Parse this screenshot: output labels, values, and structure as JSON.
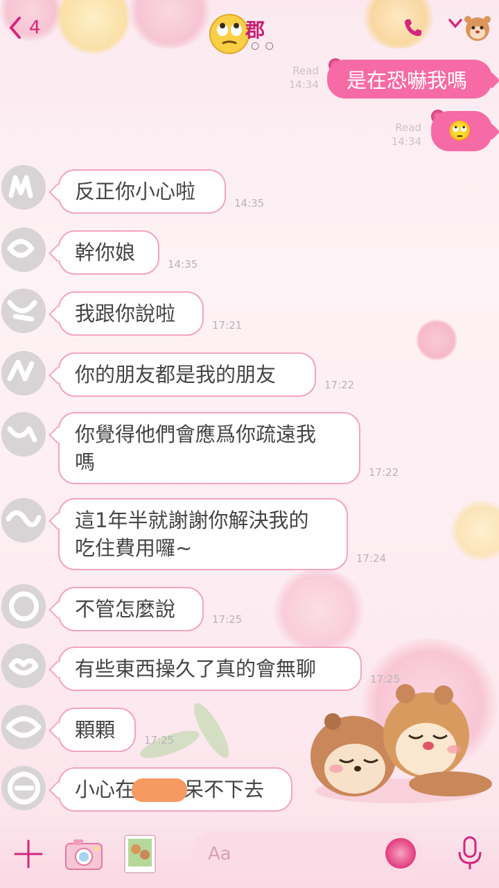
{
  "header": {
    "back_count": "4",
    "title": "郡",
    "title_emoji": "🙄",
    "title_dots": "○ ○"
  },
  "outgoing": [
    {
      "text": "是在恐嚇我嗎",
      "read": "Read",
      "time": "14:34"
    },
    {
      "text": "🙄",
      "read": "Read",
      "time": "14:34"
    }
  ],
  "incoming": [
    {
      "lines": [
        "反正你小心啦"
      ],
      "time": "14:35"
    },
    {
      "lines": [
        "幹你娘"
      ],
      "time": "14:35"
    },
    {
      "lines": [
        "我跟你說啦"
      ],
      "time": "17:21"
    },
    {
      "lines": [
        "你的朋友都是我的朋友"
      ],
      "time": "17:22"
    },
    {
      "lines": [
        "你覺得他們會應爲你疏遠我",
        "嗎"
      ],
      "time": "17:22"
    },
    {
      "lines": [
        "這1年半就謝謝你解決我的",
        "吃住費用囉~"
      ],
      "time": "17:24"
    },
    {
      "lines": [
        "不管怎麼說"
      ],
      "time": "17:25"
    },
    {
      "lines": [
        "有些東西操久了真的會無聊"
      ],
      "time": "17:25"
    },
    {
      "lines": [
        "顆顆"
      ],
      "time": "17:25"
    },
    {
      "lines": [
        "小心在",
        "呆不下去"
      ],
      "time": ""
    }
  ],
  "input": {
    "placeholder": "Aa"
  },
  "colors": {
    "accent": "#d3267d",
    "outgoing_bubble": "#f66ba5",
    "incoming_border": "#f2a4c0"
  },
  "icons": {
    "back": "chevron-left-icon",
    "call": "phone-icon",
    "menu": "chevron-down-icon",
    "plus": "plus-icon",
    "camera": "camera-icon",
    "image": "image-icon",
    "emoji": "emoji-icon",
    "mic": "microphone-icon"
  }
}
